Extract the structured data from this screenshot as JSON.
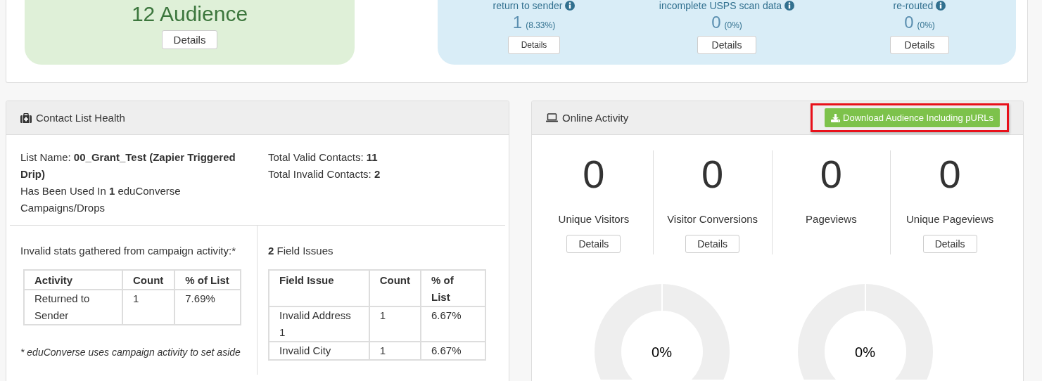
{
  "audience_card": {
    "title": "12 Audience",
    "button": "Details"
  },
  "mail_stats": [
    {
      "label": "return to sender",
      "count": "1",
      "percent": "(8.33%)",
      "button": "Details"
    },
    {
      "label": "incomplete USPS scan data",
      "count": "0",
      "percent": "(0%)",
      "button": "Details"
    },
    {
      "label": "re-routed",
      "count": "0",
      "percent": "(0%)",
      "button": "Details"
    }
  ],
  "contact_list_health": {
    "title": "Contact List Health",
    "list_info": [
      "List Name: **00_Grant_Test (Zapier Triggered Drip)**",
      "Has Been Used In **1** eduConverse Campaigns/Drops"
    ],
    "totals": [
      "Total Valid Contacts: **11**",
      "Total Invalid Contacts: **2**"
    ],
    "invalid_stats_intro": "Invalid stats gathered from campaign activity:*",
    "activity_table": {
      "columns": [
        "Activity",
        "Count",
        "% of List"
      ],
      "rows": [
        [
          "Returned to Sender",
          "1",
          "7.69%"
        ]
      ]
    },
    "field_issues_title": "**2** Field Issues",
    "field_issue_table": {
      "columns": [
        "Field Issue",
        "Count",
        "% of List"
      ],
      "rows": [
        [
          "Invalid Address 1",
          "1",
          "6.67%"
        ],
        [
          "Invalid City",
          "1",
          "6.67%"
        ]
      ]
    },
    "footnote": "* eduConverse uses campaign activity to set aside"
  },
  "online_activity": {
    "title": "Online Activity",
    "download_button": {
      "label": "Download Audience Including pURLs",
      "highlighted": true
    },
    "metrics": [
      {
        "value": "0",
        "label": "Unique Visitors",
        "button": "Details"
      },
      {
        "value": "0",
        "label": "Visitor Conversions",
        "button": "Details"
      },
      {
        "value": "0",
        "label": "Pageviews"
      },
      {
        "value": "0",
        "label": "Unique Pageviews",
        "button": "Details"
      }
    ],
    "donuts": [
      {
        "label": "0%"
      },
      {
        "label": "0%"
      }
    ]
  }
}
